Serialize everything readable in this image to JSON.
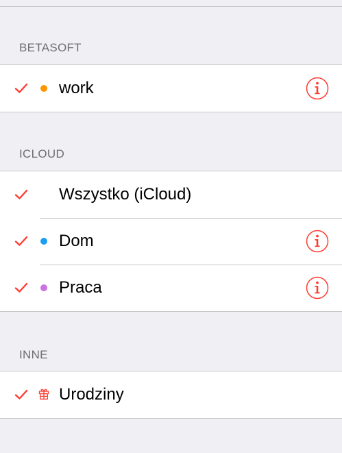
{
  "colors": {
    "accent": "#ff3b30",
    "background": "#efeff4",
    "separator": "#c8c7cc",
    "header_text": "#6d6d72"
  },
  "sections": [
    {
      "header": "BETASOFT",
      "items": [
        {
          "label": "work",
          "checked": true,
          "color_dot": "#ff9500",
          "has_info": true
        }
      ]
    },
    {
      "header": "ICLOUD",
      "items": [
        {
          "label": "Wszystko (iCloud)",
          "checked": true,
          "color_dot": null,
          "has_info": false
        },
        {
          "label": "Dom",
          "checked": true,
          "color_dot": "#1a9ff0",
          "has_info": true
        },
        {
          "label": "Praca",
          "checked": true,
          "color_dot": "#cc73e1",
          "has_info": true
        }
      ]
    },
    {
      "header": "INNE",
      "items": [
        {
          "label": "Urodziny",
          "checked": true,
          "icon": "gift-icon",
          "has_info": false
        }
      ]
    }
  ]
}
